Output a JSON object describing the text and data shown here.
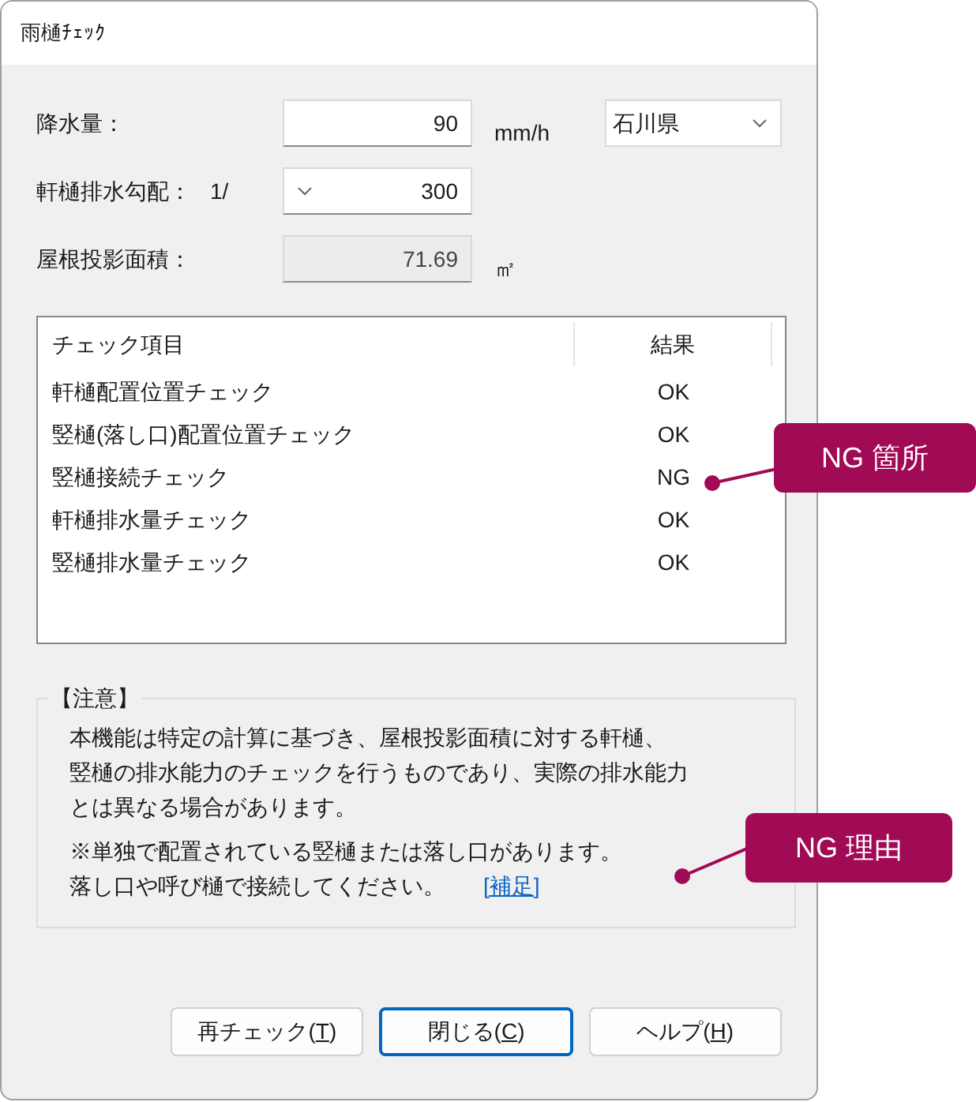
{
  "window": {
    "title": "雨樋ﾁｪｯｸ"
  },
  "fields": [
    {
      "label": "降水量：",
      "value": "90",
      "kind": "text",
      "unit": "mm/h",
      "disabled": false
    },
    {
      "label": "軒樋排水勾配：",
      "prefix": "1/",
      "value": "300",
      "kind": "spin",
      "disabled": false
    },
    {
      "label": "屋根投影面積：",
      "value": "71.69",
      "kind": "text",
      "unit": "㎡",
      "disabled": true
    }
  ],
  "region_select": {
    "value": "石川県"
  },
  "table": {
    "columns": [
      "チェック項目",
      "結果"
    ],
    "rows": [
      {
        "item": "軒樋配置位置チェック",
        "result": "OK"
      },
      {
        "item": "竪樋(落し口)配置位置チェック",
        "result": "OK"
      },
      {
        "item": "竪樋接続チェック",
        "result": "NG"
      },
      {
        "item": "軒樋排水量チェック",
        "result": "OK"
      },
      {
        "item": "竪樋排水量チェック",
        "result": "OK"
      }
    ]
  },
  "notice": {
    "title": "【注意】",
    "lines": [
      "本機能は特定の計算に基づき、屋根投影面積に対する軒樋、",
      "竪樋の排水能力のチェックを行うものであり、実際の排水能力",
      "とは異なる場合があります。"
    ],
    "message_lines": [
      "※単独で配置されている竪樋または落し口があります。",
      "落し口や呼び樋で接続してください。"
    ],
    "link": "[補足]"
  },
  "buttons": [
    {
      "label": "再チェック(T)",
      "default": false
    },
    {
      "label": "閉じる(C)",
      "default": true
    },
    {
      "label": "ヘルプ(H)",
      "default": false
    }
  ],
  "callouts": [
    {
      "text": "NG 箇所"
    },
    {
      "text": "NG 理由"
    }
  ]
}
